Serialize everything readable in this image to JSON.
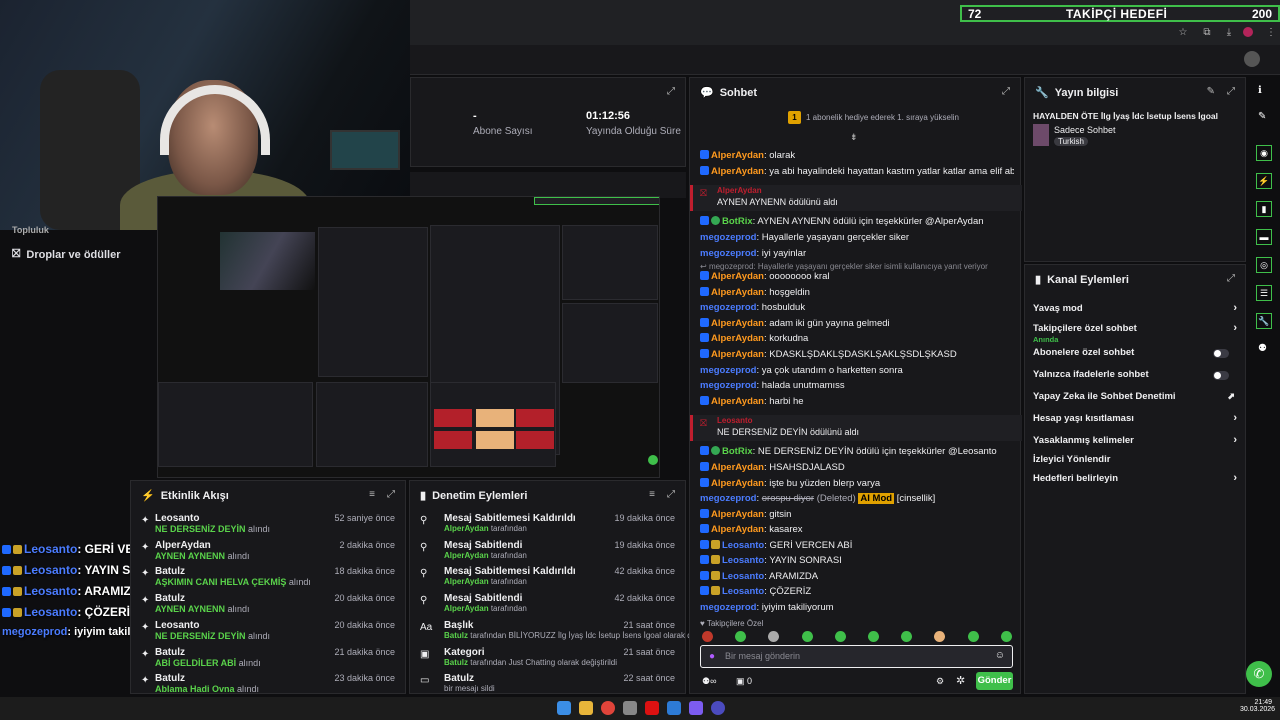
{
  "goal": {
    "value": "72",
    "label": "TAKİPÇİ HEDEFİ",
    "target": "200"
  },
  "sidebar": {
    "item1": "Droplar ve ödüller",
    "item0": "Topluluk"
  },
  "stream_stats": {
    "subs_value": "-",
    "subs_label": "Abone Sayısı",
    "uptime_value": "01:12:56",
    "uptime_label": "Yayında Olduğu Süre"
  },
  "chat": {
    "title": "Sohbet",
    "banner": "1 abonelik hediye ederek 1. sıraya yükselin",
    "banner_badge": "1",
    "pinned_label": "Takipçilere Özel",
    "input_placeholder": "Bir mesaj gönderin",
    "send": "Gönder",
    "viewers": "0",
    "messages": [
      {
        "user": "AlperAydan",
        "cls": "u-alper",
        "text": ": olarak"
      },
      {
        "user": "AlperAydan",
        "cls": "u-alper",
        "text": ": ya abi hayalindeki hayattan kastım yatlar katlar ama elif abla yok"
      },
      {
        "user": "BotRix",
        "cls": "u-bot",
        "text": ": AYNEN AYNENN ödülü için teşekkürler @AlperAydan"
      },
      {
        "user": "megozeprod",
        "cls": "u-mego",
        "text": ": Hayallerle yaşayanı gerçekler siker"
      },
      {
        "user": "megozeprod",
        "cls": "u-mego",
        "text": ": iyi yayinlar"
      },
      {
        "user": "AlperAydan",
        "cls": "u-alper",
        "text": ": oooooooo kral"
      },
      {
        "user": "AlperAydan",
        "cls": "u-alper",
        "text": ": hoşgeldin"
      },
      {
        "user": "megozeprod",
        "cls": "u-mego",
        "text": ": hosbulduk"
      },
      {
        "user": "AlperAydan",
        "cls": "u-alper",
        "text": ": adam iki gün yayına gelmedi"
      },
      {
        "user": "AlperAydan",
        "cls": "u-alper",
        "text": ": korkudna"
      },
      {
        "user": "AlperAydan",
        "cls": "u-alper",
        "text": ": KDASKLŞDAKLŞDASKLŞAKLŞSDLŞKASD"
      },
      {
        "user": "megozeprod",
        "cls": "u-mego",
        "text": ": ya çok utandım o harketten sonra"
      },
      {
        "user": "megozeprod",
        "cls": "u-mego",
        "text": ": halada unutmamıss"
      },
      {
        "user": "AlperAydan",
        "cls": "u-alper",
        "text": ": harbi he"
      },
      {
        "user": "BotRix",
        "cls": "u-bot",
        "text": ": NE DERSENİZ DEYİN ödülü için teşekkürler @Leosanto"
      },
      {
        "user": "AlperAydan",
        "cls": "u-alper",
        "text": ": HSAHSDJALASD"
      },
      {
        "user": "AlperAydan",
        "cls": "u-alper",
        "text": ": işte bu yüzden blerp varya"
      },
      {
        "user": "AlperAydan",
        "cls": "u-alper",
        "text": ": gitsin"
      },
      {
        "user": "AlperAydan",
        "cls": "u-alper",
        "text": ": kasarex"
      },
      {
        "user": "Leosanto",
        "cls": "u-leo",
        "text": ": GERİ VERCEN ABİ"
      },
      {
        "user": "Leosanto",
        "cls": "u-leo",
        "text": ": YAYIN SONRASI"
      },
      {
        "user": "Leosanto",
        "cls": "u-leo",
        "text": ": ARAMIZDA"
      },
      {
        "user": "Leosanto",
        "cls": "u-leo",
        "text": ": ÇÖZERİZ"
      },
      {
        "user": "megozeprod",
        "cls": "u-mego",
        "text": ": iyiyim takiliyorum"
      }
    ],
    "redeem1_user": "AlperAydan",
    "redeem1_text": "AYNEN AYNENN ödülünü aldı",
    "redeem2_user": "Leosanto",
    "redeem2_text": "NE DERSENİZ DEYİN ödülünü aldı",
    "deleted_user": "megozeprod",
    "deleted_text": ": Hayallerle yaşayanı gerçekler siker isimli kullanıcıya yanıt veriyor",
    "deleted2_user": "megozeprod",
    "deleted2_word": "orospu diyor",
    "deleted2_tag": "(Deleted)",
    "deleted2_mod": "AI Mod",
    "deleted2_reason": "[cinsellik]"
  },
  "stream_info": {
    "title": "Yayın bilgisi",
    "stream_title": "HAYALDEN ÖTE İlg İyaş İdc İsetup İsens İgoal",
    "category": "Sadece Sohbet",
    "tag": "Turkish"
  },
  "channel_actions": {
    "title": "Kanal Eylemleri",
    "rows": [
      {
        "label": "Yavaş mod",
        "kind": "chev"
      },
      {
        "label": "Takipçilere özel sohbet",
        "sub": "Anında",
        "kind": "chev"
      },
      {
        "label": "Abonelere özel sohbet",
        "kind": "toggle"
      },
      {
        "label": "Yalnızca ifadelerle sohbet",
        "kind": "toggle"
      },
      {
        "label": "Yapay Zeka ile Sohbet Denetimi",
        "kind": "ext"
      },
      {
        "label": "Hesap yaşı kısıtlaması",
        "kind": "chev"
      },
      {
        "label": "Yasaklanmış kelimeler",
        "kind": "chev"
      },
      {
        "label": "İzleyici Yönlendir",
        "kind": "none"
      },
      {
        "label": "Hedefleri belirleyin",
        "kind": "chev"
      }
    ]
  },
  "activity": {
    "title": "Etkinlik Akışı",
    "items": [
      {
        "user": "Leosanto",
        "desc_b": "NE DERSENİZ DEYİN",
        "desc": " alındı",
        "time": "52 saniye önce"
      },
      {
        "user": "AlperAydan",
        "desc_b": "AYNEN AYNENN",
        "desc": " alındı",
        "time": "2 dakika önce"
      },
      {
        "user": "Batulz",
        "desc_b": "AŞKIMIN CANI HELVA ÇEKMİŞ",
        "desc": " alındı",
        "time": "18 dakika önce"
      },
      {
        "user": "Batulz",
        "desc_b": "AYNEN AYNENN",
        "desc": " alındı",
        "time": "20 dakika önce"
      },
      {
        "user": "Leosanto",
        "desc_b": "NE DERSENİZ DEYİN",
        "desc": " alındı",
        "time": "20 dakika önce"
      },
      {
        "user": "Batulz",
        "desc_b": "ABİ GELDİLER ABİ",
        "desc": " alındı",
        "time": "21 dakika önce"
      },
      {
        "user": "Batulz",
        "desc_b": "Ablama Hadi Ovna",
        "desc": " alındı",
        "time": "23 dakika önce"
      }
    ]
  },
  "mod_actions": {
    "title": "Denetim Eylemleri",
    "items": [
      {
        "title": "Mesaj Sabitlemesi Kaldırıldı",
        "user": "AlperAydan",
        "desc": " tarafından",
        "time": "19 dakika önce",
        "icon": "⚲"
      },
      {
        "title": "Mesaj Sabitlendi",
        "user": "AlperAydan",
        "desc": " tarafından",
        "time": "19 dakika önce",
        "icon": "⚲"
      },
      {
        "title": "Mesaj Sabitlemesi Kaldırıldı",
        "user": "AlperAydan",
        "desc": " tarafından",
        "time": "42 dakika önce",
        "icon": "⚲"
      },
      {
        "title": "Mesaj Sabitlendi",
        "user": "AlperAydan",
        "desc": " tarafından",
        "time": "42 dakika önce",
        "icon": "⚲"
      },
      {
        "title": "Başlık",
        "user": "Batulz",
        "desc": " tarafından BİLİYORUZZ İlg İyaş İdc İsetup İsens İgoal olarak değiştirildi",
        "time": "21 saat önce",
        "icon": "Aa"
      },
      {
        "title": "Kategori",
        "user": "Batulz",
        "desc": " tarafından Just Chatting olarak değiştirildi",
        "time": "21 saat önce",
        "icon": "▣"
      },
      {
        "title": "Batulz",
        "user": "",
        "desc": "bir mesajı sildi",
        "time": "22 saat önce",
        "icon": "▭"
      }
    ]
  },
  "overlay": [
    {
      "user": "Leosanto",
      "text": ": GERİ VERCEN ABİ"
    },
    {
      "user": "Leosanto",
      "text": ": YAYIN SONRASI"
    },
    {
      "user": "Leosanto",
      "text": ": ARAMIZDA"
    },
    {
      "user": "Leosanto",
      "text": ": ÇÖZERİZ"
    },
    {
      "user": "megozeprod",
      "text": ": iyiyim takiliyorum"
    }
  ],
  "taskbar": {
    "time": "21:49",
    "date": "30.03.2026"
  },
  "colors": {
    "accent": "#3fbf4a",
    "panel": "#18181b",
    "bg": "#0e0e10"
  }
}
